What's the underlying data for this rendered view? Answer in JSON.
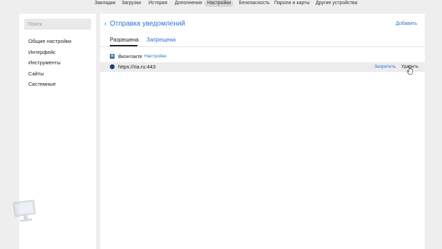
{
  "topnav": {
    "tabs": [
      {
        "label": "Закладки"
      },
      {
        "label": "Загрузки"
      },
      {
        "label": "История"
      },
      {
        "label": "Дополнения"
      },
      {
        "label": "Настройки",
        "active": true
      },
      {
        "label": "Безопасность"
      },
      {
        "label": "Пароли и карты"
      },
      {
        "label": "Другие устройства"
      }
    ]
  },
  "sidebar": {
    "search_placeholder": "Поиск",
    "items": [
      {
        "label": "Общие настройки"
      },
      {
        "label": "Интерфейс"
      },
      {
        "label": "Инструменты"
      },
      {
        "label": "Сайты"
      },
      {
        "label": "Системные"
      }
    ]
  },
  "main": {
    "back_icon": "chevron-left-icon",
    "title": "Отправка уведомлений",
    "add_label": "Добавить",
    "tabs": [
      {
        "label": "Разрешена",
        "active": true
      },
      {
        "label": "Запрещена",
        "active": false
      }
    ],
    "rows": [
      {
        "site": "Вконтакте",
        "favicon": "vk-icon",
        "settings_label": "Настройки"
      },
      {
        "site": "https://ria.ru:443",
        "favicon": "ria-icon",
        "deny_label": "Запретить",
        "delete_label": "Удалить",
        "highlighted": true
      }
    ]
  },
  "colors": {
    "accent": "#2c6fd1",
    "page_bg": "#eeeeee",
    "panel_bg": "#ffffff",
    "row_highlight": "#ececec"
  }
}
